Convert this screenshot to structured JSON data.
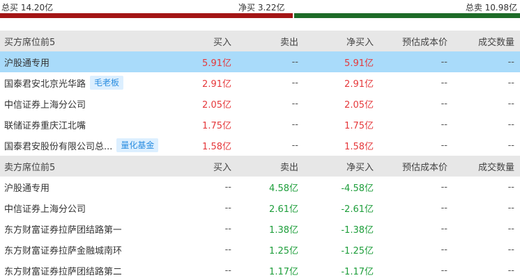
{
  "summary": {
    "total_buy": "总买 14.20亿",
    "net_buy": "净买 3.22亿",
    "total_sell": "总卖 10.98亿",
    "buy_fraction": 0.564,
    "colors": {
      "buy_bar": "#a31515",
      "sell_bar": "#1d6b27"
    }
  },
  "columns": [
    "买入",
    "卖出",
    "净买入",
    "预估成本价",
    "成交数量"
  ],
  "buy_section": {
    "header": "买方席位前5",
    "rows": [
      {
        "name": "沪股通专用",
        "tag": "",
        "buy": "5.91亿",
        "sell": "--",
        "net": "5.91亿",
        "cost": "--",
        "volume": "--",
        "highlighted": true
      },
      {
        "name": "国泰君安北京光华路",
        "tag": "毛老板",
        "buy": "2.91亿",
        "sell": "--",
        "net": "2.91亿",
        "cost": "--",
        "volume": "--"
      },
      {
        "name": "中信证券上海分公司",
        "tag": "",
        "buy": "2.05亿",
        "sell": "--",
        "net": "2.05亿",
        "cost": "--",
        "volume": "--"
      },
      {
        "name": "联储证券重庆江北嘴",
        "tag": "",
        "buy": "1.75亿",
        "sell": "--",
        "net": "1.75亿",
        "cost": "--",
        "volume": "--"
      },
      {
        "name": "国泰君安股份有限公司总...",
        "tag": "量化基金",
        "buy": "1.58亿",
        "sell": "--",
        "net": "1.58亿",
        "cost": "--",
        "volume": "--"
      }
    ]
  },
  "sell_section": {
    "header": "卖方席位前5",
    "rows": [
      {
        "name": "沪股通专用",
        "tag": "",
        "buy": "--",
        "sell": "4.58亿",
        "net": "-4.58亿",
        "cost": "--",
        "volume": "--"
      },
      {
        "name": "中信证券上海分公司",
        "tag": "",
        "buy": "--",
        "sell": "2.61亿",
        "net": "-2.61亿",
        "cost": "--",
        "volume": "--"
      },
      {
        "name": "东方财富证券拉萨团结路第一",
        "tag": "",
        "buy": "--",
        "sell": "1.38亿",
        "net": "-1.38亿",
        "cost": "--",
        "volume": "--"
      },
      {
        "name": "东方财富证券拉萨金融城南环路",
        "tag": "",
        "buy": "--",
        "sell": "1.25亿",
        "net": "-1.25亿",
        "cost": "--",
        "volume": "--"
      },
      {
        "name": "东方财富证券拉萨团结路第二",
        "tag": "",
        "buy": "--",
        "sell": "1.17亿",
        "net": "-1.17亿",
        "cost": "--",
        "volume": "--"
      }
    ]
  }
}
